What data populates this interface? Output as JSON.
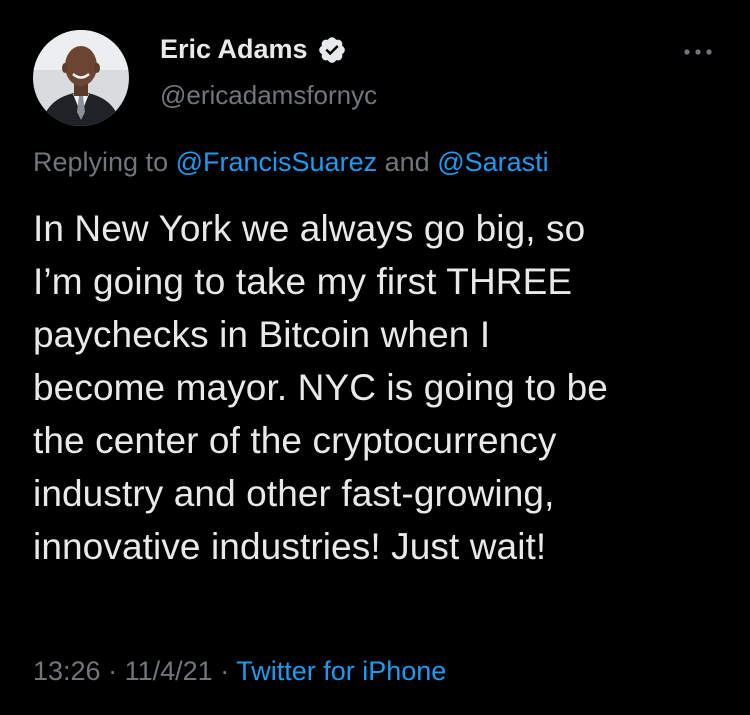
{
  "tweet": {
    "author": {
      "display_name": "Eric Adams",
      "handle": "@ericadamsfornyc",
      "verified_icon": "verified-badge-icon",
      "avatar_icon": "profile-photo"
    },
    "more_icon": "more-options-icon",
    "reply": {
      "prefix": "Replying to",
      "mention_1": "@FrancisSuarez",
      "joiner": "and",
      "mention_2": "@Sarasti"
    },
    "text_lines": [
      "In New York we always go big, so",
      "I’m going to take my first THREE",
      "paychecks in Bitcoin when I",
      "become mayor. NYC is going to be",
      "the center of the cryptocurrency",
      "industry and other fast-growing,",
      "innovative industries! Just wait!"
    ],
    "meta": {
      "time": "13:26",
      "separator_1": "·",
      "date": "11/4/21",
      "separator_2": "·",
      "source": "Twitter for iPhone"
    }
  },
  "colors": {
    "background": "#000000",
    "text": "#e7e9ea",
    "muted": "#71767b",
    "accent": "#1d9bf0"
  }
}
